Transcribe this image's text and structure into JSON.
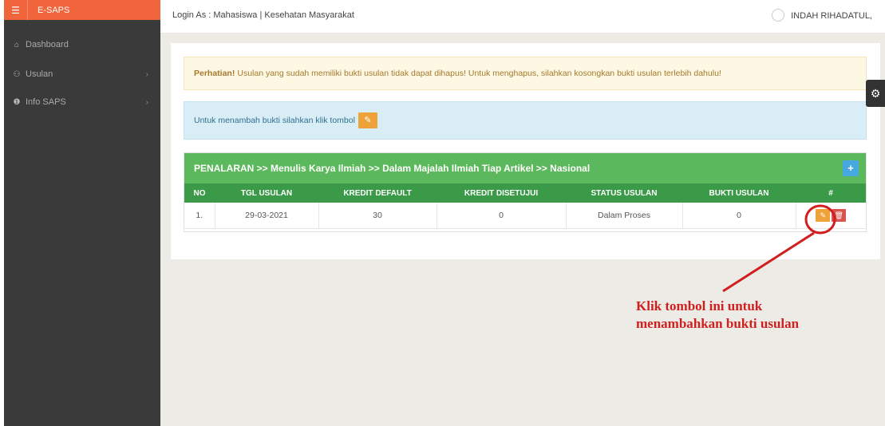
{
  "sidebar": {
    "brand": "E-SAPS",
    "items": [
      {
        "icon": "home-icon",
        "glyph": "⌂",
        "label": "Dashboard"
      },
      {
        "icon": "usulan-icon",
        "glyph": "⚇",
        "label": "Usulan",
        "chevron": "›"
      },
      {
        "icon": "info-icon",
        "glyph": "❶",
        "label": "Info SAPS",
        "chevron": "›"
      }
    ]
  },
  "topbar": {
    "login_text": "Login As : Mahasiswa | Kesehatan Masyarakat",
    "user_name": "INDAH RIHADATUL,"
  },
  "alerts": {
    "warning_strong": "Perhatian!",
    "warning_text": "Usulan yang sudah memiliki bukti usulan tidak dapat dihapus! Untuk menghapus, silahkan kosongkan bukti usulan terlebih dahulu!",
    "info_text": "Untuk menambah bukti silahkan klik tombol"
  },
  "table": {
    "title": "PENALARAN >> Menulis Karya Ilmiah >> Dalam Majalah Ilmiah Tiap Artikel >> Nasional",
    "columns": [
      "NO",
      "TGL USULAN",
      "KREDIT DEFAULT",
      "KREDIT DISETUJUI",
      "STATUS USULAN",
      "BUKTI USULAN",
      "#"
    ],
    "rows": [
      {
        "no": "1.",
        "tgl": "29-03-2021",
        "kredit_default": "30",
        "kredit_disetujui": "0",
        "status": "Dalam Proses",
        "bukti": "0"
      }
    ]
  },
  "annotation": {
    "line1": "Klik tombol ini untuk",
    "line2": "menambahkan bukti usulan",
    "color": "#d11f1f"
  },
  "colors": {
    "brand": "#f0653b",
    "sidebar": "#3a3a3a",
    "table_header": "#5cb85c",
    "edit_button": "#f0a23a",
    "delete_button": "#d9534f",
    "add_button": "#45a8e0"
  }
}
